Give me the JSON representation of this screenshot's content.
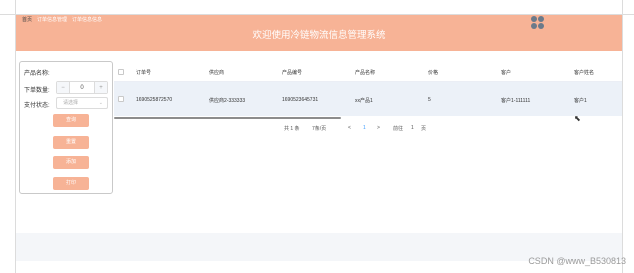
{
  "nav": {
    "items": [
      "首页",
      "订单信息管理",
      "订单信息信息"
    ]
  },
  "header": {
    "title": "欢迎使用冷链物流信息管理系统"
  },
  "filter": {
    "name_label": "产品名称:",
    "qty_label": "下单数量:",
    "qty_minus": "−",
    "qty_value": "0",
    "qty_plus": "+",
    "status_label": "支付状态:",
    "status_placeholder": "请选择",
    "buttons": [
      "查询",
      "重置",
      "添加",
      "打印"
    ]
  },
  "table": {
    "columns": [
      "订单号",
      "供应商",
      "产品编号",
      "产品名称",
      "价格",
      "客户",
      "客户姓名"
    ],
    "rows": [
      [
        "1690525872570",
        "供应商2-333333",
        "1690523645731",
        "xx产品1",
        "5",
        "客户1-111111",
        "客户1"
      ]
    ]
  },
  "pagination": {
    "total": "共 1 条",
    "page_size": "7条/页",
    "prev": "<",
    "current": "1",
    "next": ">",
    "goto_label": "前往",
    "goto_value": "1",
    "page_suffix": "页"
  },
  "watermark": "CSDN @www_B530813",
  "colors": {
    "accent": "#f7b396",
    "row_highlight": "#ecf1f8",
    "link": "#409eff"
  }
}
